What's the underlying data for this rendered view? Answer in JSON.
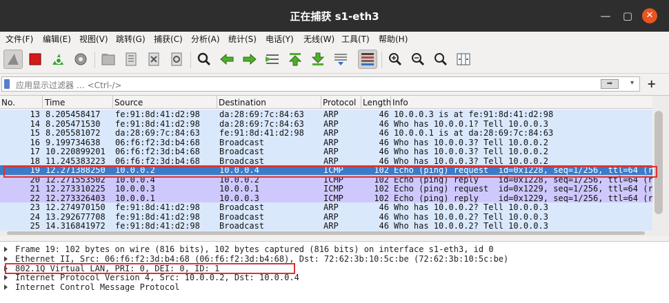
{
  "window": {
    "title": "正在捕获 s1-eth3"
  },
  "menu": [
    "文件(F)",
    "编辑(E)",
    "视图(V)",
    "跳转(G)",
    "捕获(C)",
    "分析(A)",
    "统计(S)",
    "电话(Y)",
    "无线(W)",
    "工具(T)",
    "帮助(H)"
  ],
  "filter": {
    "placeholder": "应用显示过滤器 … <Ctrl-/>",
    "apply_icon": "arrow-right-icon",
    "plus": "+"
  },
  "columns": [
    "No.",
    "Time",
    "Source",
    "Destination",
    "Protocol",
    "Length",
    "Info"
  ],
  "colors": {
    "arp": "#dae8fc",
    "icmp": "#cfc8fc",
    "selected": "#3a7cc7",
    "highlight_box": "#e03030"
  },
  "packets": [
    {
      "no": "13",
      "time": "8.205458417",
      "src": "fe:91:8d:41:d2:98",
      "dst": "da:28:69:7c:84:63",
      "proto": "ARP",
      "len": "46",
      "info": "10.0.0.3 is at fe:91:8d:41:d2:98",
      "kind": "arp"
    },
    {
      "no": "14",
      "time": "8.205471530",
      "src": "fe:91:8d:41:d2:98",
      "dst": "da:28:69:7c:84:63",
      "proto": "ARP",
      "len": "46",
      "info": "Who has 10.0.0.1? Tell 10.0.0.3",
      "kind": "arp"
    },
    {
      "no": "15",
      "time": "8.205581072",
      "src": "da:28:69:7c:84:63",
      "dst": "fe:91:8d:41:d2:98",
      "proto": "ARP",
      "len": "46",
      "info": "10.0.0.1 is at da:28:69:7c:84:63",
      "kind": "arp"
    },
    {
      "no": "16",
      "time": "9.199734638",
      "src": "06:f6:f2:3d:b4:68",
      "dst": "Broadcast",
      "proto": "ARP",
      "len": "46",
      "info": "Who has 10.0.0.3? Tell 10.0.0.2",
      "kind": "arp"
    },
    {
      "no": "17",
      "time": "10.220899201",
      "src": "06:f6:f2:3d:b4:68",
      "dst": "Broadcast",
      "proto": "ARP",
      "len": "46",
      "info": "Who has 10.0.0.3? Tell 10.0.0.2",
      "kind": "arp"
    },
    {
      "no": "18",
      "time": "11.245383223",
      "src": "06:f6:f2:3d:b4:68",
      "dst": "Broadcast",
      "proto": "ARP",
      "len": "46",
      "info": "Who has 10.0.0.3? Tell 10.0.0.2",
      "kind": "arp"
    },
    {
      "no": "19",
      "time": "12.271388250",
      "src": "10.0.0.2",
      "dst": "10.0.0.4",
      "proto": "ICMP",
      "len": "102",
      "info": "Echo (ping) request  id=0x1228, seq=1/256, ttl=64 (r",
      "kind": "selected"
    },
    {
      "no": "20",
      "time": "12.271553502",
      "src": "10.0.0.4",
      "dst": "10.0.0.2",
      "proto": "ICMP",
      "len": "102",
      "info": "Echo (ping) reply    id=0x1228, seq=1/256, ttl=64 (r",
      "kind": "icmp"
    },
    {
      "no": "21",
      "time": "12.273310225",
      "src": "10.0.0.3",
      "dst": "10.0.0.1",
      "proto": "ICMP",
      "len": "102",
      "info": "Echo (ping) request  id=0x1229, seq=1/256, ttl=64 (r",
      "kind": "icmp"
    },
    {
      "no": "22",
      "time": "12.273326403",
      "src": "10.0.0.1",
      "dst": "10.0.0.3",
      "proto": "ICMP",
      "len": "102",
      "info": "Echo (ping) reply    id=0x1229, seq=1/256, ttl=64 (r",
      "kind": "icmp"
    },
    {
      "no": "23",
      "time": "12.274970150",
      "src": "fe:91:8d:41:d2:98",
      "dst": "Broadcast",
      "proto": "ARP",
      "len": "46",
      "info": "Who has 10.0.0.2? Tell 10.0.0.3",
      "kind": "arp"
    },
    {
      "no": "24",
      "time": "13.292677708",
      "src": "fe:91:8d:41:d2:98",
      "dst": "Broadcast",
      "proto": "ARP",
      "len": "46",
      "info": "Who has 10.0.0.2? Tell 10.0.0.3",
      "kind": "arp"
    },
    {
      "no": "25",
      "time": "14.316841972",
      "src": "fe:91:8d:41:d2:98",
      "dst": "Broadcast",
      "proto": "ARP",
      "len": "46",
      "info": "Who has 10.0.0.2? Tell 10.0.0.3",
      "kind": "arp"
    }
  ],
  "details": [
    "Frame 19: 102 bytes on wire (816 bits), 102 bytes captured (816 bits) on interface s1-eth3, id 0",
    "Ethernet II, Src: 06:f6:f2:3d:b4:68 (06:f6:f2:3d:b4:68), Dst: 72:62:3b:10:5c:be (72:62:3b:10:5c:be)",
    "802.1Q Virtual LAN, PRI: 0, DEI: 0, ID: 1",
    "Internet Protocol Version 4, Src: 10.0.0.2, Dst: 10.0.0.4",
    "Internet Control Message Protocol"
  ]
}
